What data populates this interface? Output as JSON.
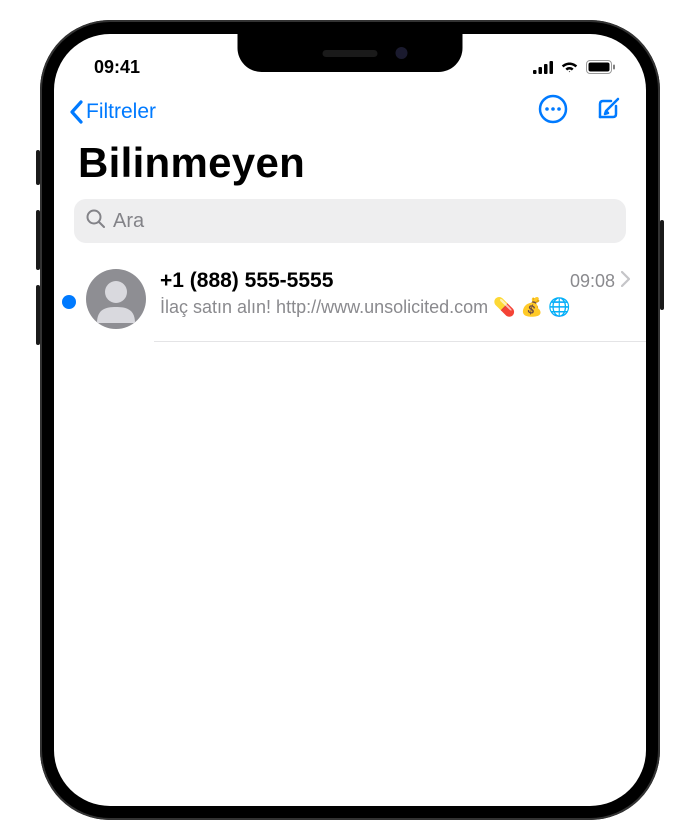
{
  "status_bar": {
    "time": "09:41"
  },
  "nav": {
    "back_label": "Filtreler"
  },
  "page": {
    "title": "Bilinmeyen"
  },
  "search": {
    "placeholder": "Ara"
  },
  "messages": [
    {
      "sender": "+1 (888) 555-5555",
      "time": "09:08",
      "preview": "İlaç satın alın! http://www.unsolicited.com 💊 💰 🌐",
      "unread": true
    }
  ]
}
